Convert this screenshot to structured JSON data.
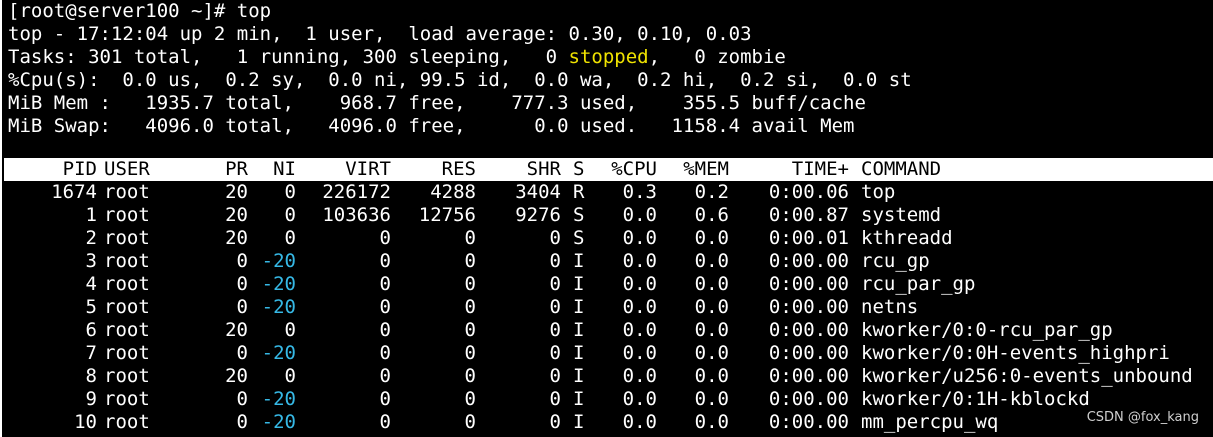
{
  "prompt": "[root@server100 ~]# top",
  "summary": {
    "line1": "top - 17:12:04 up 2 min,  1 user,  load average: 0.30, 0.10, 0.03",
    "tasks_prefix": "Tasks: 301 total,   1 running, 300 sleeping,   0 ",
    "tasks_stopped": "stopped",
    "tasks_suffix": ",   0 zombie",
    "cpu": "%Cpu(s):  0.0 us,  0.2 sy,  0.0 ni, 99.5 id,  0.0 wa,  0.2 hi,  0.2 si,  0.0 st",
    "mem": "MiB Mem :   1935.7 total,    968.7 free,    777.3 used,    355.5 buff/cache",
    "swap": "MiB Swap:   4096.0 total,   4096.0 free,      0.0 used.   1158.4 avail Mem"
  },
  "columns": {
    "pid": "PID",
    "user": "USER",
    "pr": "PR",
    "ni": "NI",
    "virt": "VIRT",
    "res": "RES",
    "shr": "SHR",
    "s": "S",
    "cpu": "%CPU",
    "mem": "%MEM",
    "time": "TIME+",
    "command": "COMMAND"
  },
  "processes": [
    {
      "pid": "1674",
      "user": "root",
      "pr": "20",
      "ni": "0",
      "virt": "226172",
      "res": "4288",
      "shr": "3404",
      "s": "R",
      "cpu": "0.3",
      "mem": "0.2",
      "time": "0:00.06",
      "command": "top"
    },
    {
      "pid": "1",
      "user": "root",
      "pr": "20",
      "ni": "0",
      "virt": "103636",
      "res": "12756",
      "shr": "9276",
      "s": "S",
      "cpu": "0.0",
      "mem": "0.6",
      "time": "0:00.87",
      "command": "systemd"
    },
    {
      "pid": "2",
      "user": "root",
      "pr": "20",
      "ni": "0",
      "virt": "0",
      "res": "0",
      "shr": "0",
      "s": "S",
      "cpu": "0.0",
      "mem": "0.0",
      "time": "0:00.01",
      "command": "kthreadd"
    },
    {
      "pid": "3",
      "user": "root",
      "pr": "0",
      "ni": "-20",
      "virt": "0",
      "res": "0",
      "shr": "0",
      "s": "I",
      "cpu": "0.0",
      "mem": "0.0",
      "time": "0:00.00",
      "command": "rcu_gp"
    },
    {
      "pid": "4",
      "user": "root",
      "pr": "0",
      "ni": "-20",
      "virt": "0",
      "res": "0",
      "shr": "0",
      "s": "I",
      "cpu": "0.0",
      "mem": "0.0",
      "time": "0:00.00",
      "command": "rcu_par_gp"
    },
    {
      "pid": "5",
      "user": "root",
      "pr": "0",
      "ni": "-20",
      "virt": "0",
      "res": "0",
      "shr": "0",
      "s": "I",
      "cpu": "0.0",
      "mem": "0.0",
      "time": "0:00.00",
      "command": "netns"
    },
    {
      "pid": "6",
      "user": "root",
      "pr": "20",
      "ni": "0",
      "virt": "0",
      "res": "0",
      "shr": "0",
      "s": "I",
      "cpu": "0.0",
      "mem": "0.0",
      "time": "0:00.00",
      "command": "kworker/0:0-rcu_par_gp"
    },
    {
      "pid": "7",
      "user": "root",
      "pr": "0",
      "ni": "-20",
      "virt": "0",
      "res": "0",
      "shr": "0",
      "s": "I",
      "cpu": "0.0",
      "mem": "0.0",
      "time": "0:00.00",
      "command": "kworker/0:0H-events_highpri"
    },
    {
      "pid": "8",
      "user": "root",
      "pr": "20",
      "ni": "0",
      "virt": "0",
      "res": "0",
      "shr": "0",
      "s": "I",
      "cpu": "0.0",
      "mem": "0.0",
      "time": "0:00.00",
      "command": "kworker/u256:0-events_unbound"
    },
    {
      "pid": "9",
      "user": "root",
      "pr": "0",
      "ni": "-20",
      "virt": "0",
      "res": "0",
      "shr": "0",
      "s": "I",
      "cpu": "0.0",
      "mem": "0.0",
      "time": "0:00.00",
      "command": "kworker/0:1H-kblockd"
    },
    {
      "pid": "10",
      "user": "root",
      "pr": "0",
      "ni": "-20",
      "virt": "0",
      "res": "0",
      "shr": "0",
      "s": "I",
      "cpu": "0.0",
      "mem": "0.0",
      "time": "0:00.00",
      "command": "mm_percpu_wq"
    }
  ],
  "watermark": "CSDN @fox_kang",
  "colors": {
    "background": "#000000",
    "foreground": "#ffffff",
    "stopped_highlight": "#f0e300",
    "negative_nice": "#36b9e6",
    "header_bg": "#ffffff",
    "header_fg": "#000000"
  }
}
